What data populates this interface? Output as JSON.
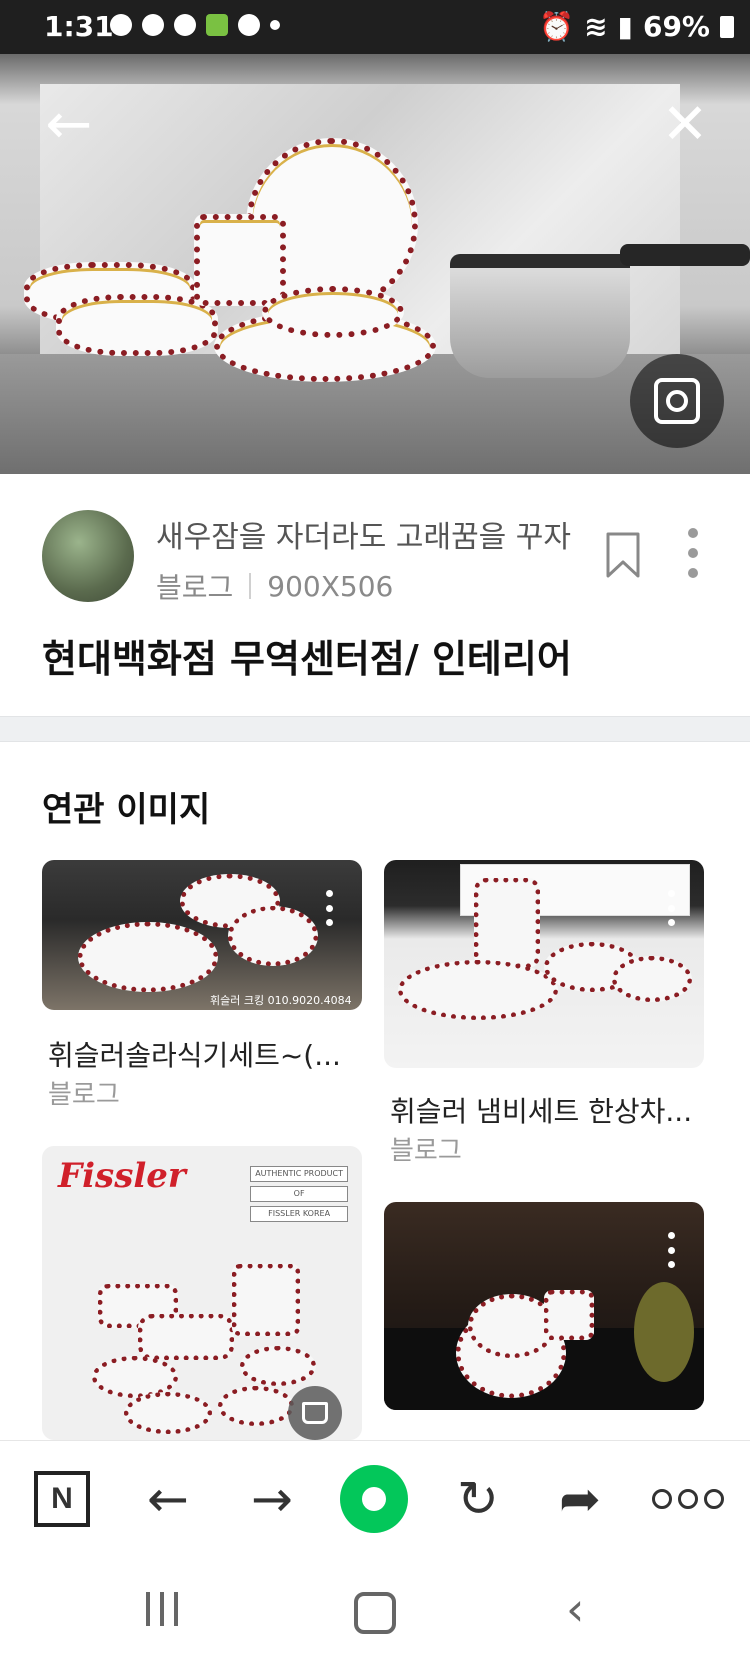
{
  "status_bar": {
    "time": "1:31",
    "battery": "69%"
  },
  "viewer": {
    "blog_name": "새우잠을 자더라도 고래꿈을 꾸자",
    "source": "블로그",
    "dimensions": "900X506",
    "title": "현대백화점 무역센터점/ 인테리어"
  },
  "related": {
    "heading": "연관 이미지",
    "items": [
      {
        "title": "휘슬러솔라식기세트~(...",
        "source": "블로그",
        "watermark": "휘슬러 크킹 010.9020.4084"
      },
      {
        "title": "휘슬러 냄비세트 한상차...",
        "source": "블로그"
      },
      {
        "logo_text": "Fissler",
        "badge": [
          "AUTHENTIC PRODUCT",
          "OF",
          "FISSLER KOREA"
        ]
      },
      {}
    ]
  },
  "toolbar": {
    "naver_label": "N",
    "back_icon": "←",
    "forward_icon": "→",
    "reload_icon": "↻",
    "share_icon": "➦"
  },
  "system_nav": {
    "back_icon": "‹"
  },
  "colors": {
    "naver_green": "#03c75a",
    "accent_red": "#8b1d23"
  }
}
